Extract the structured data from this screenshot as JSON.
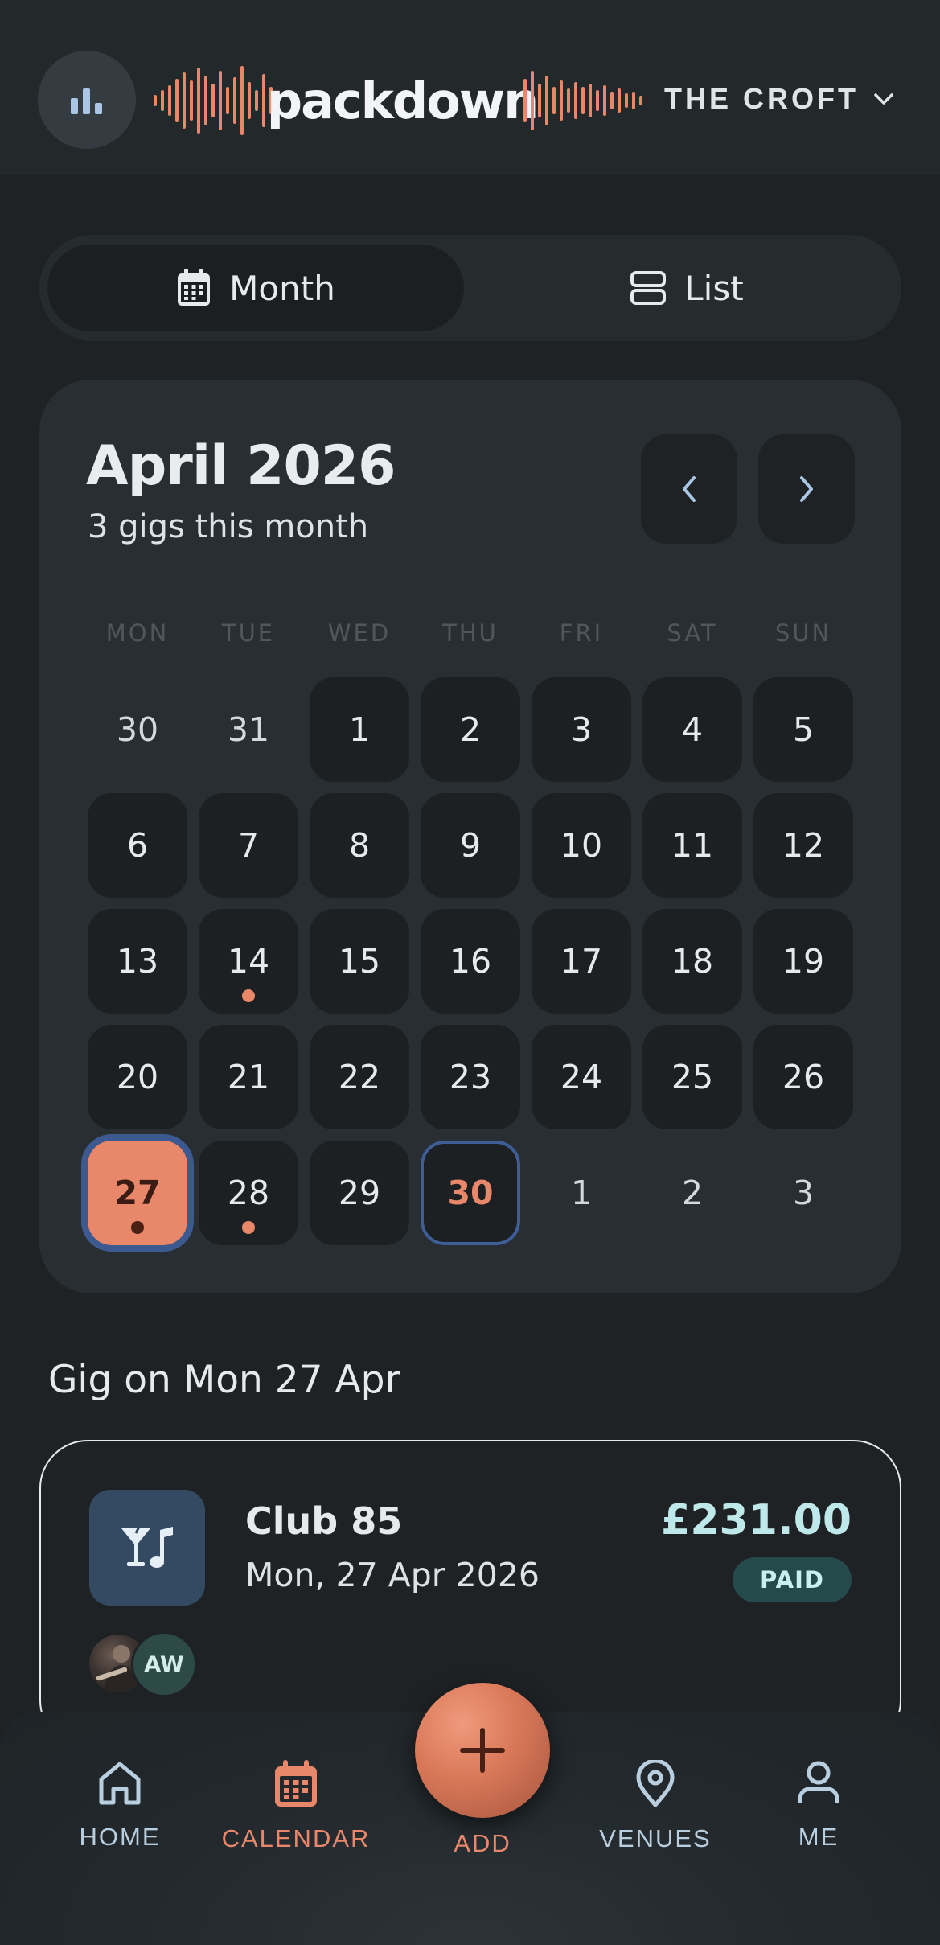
{
  "header": {
    "brand": "packdown",
    "venue": "THE CROFT",
    "icons": {
      "logo": "bar-chart-icon",
      "venue_toggle": "chevron-down-icon"
    }
  },
  "view_toggle": {
    "month_label": "Month",
    "list_label": "List",
    "active": "Month"
  },
  "calendar": {
    "title": "April 2026",
    "subtitle": "3 gigs this month",
    "weekdays": [
      "MON",
      "TUE",
      "WED",
      "THU",
      "FRI",
      "SAT",
      "SUN"
    ],
    "days": [
      {
        "label": "30",
        "in_month": false
      },
      {
        "label": "31",
        "in_month": false
      },
      {
        "label": "1",
        "in_month": true
      },
      {
        "label": "2",
        "in_month": true
      },
      {
        "label": "3",
        "in_month": true
      },
      {
        "label": "4",
        "in_month": true
      },
      {
        "label": "5",
        "in_month": true
      },
      {
        "label": "6",
        "in_month": true
      },
      {
        "label": "7",
        "in_month": true
      },
      {
        "label": "8",
        "in_month": true
      },
      {
        "label": "9",
        "in_month": true
      },
      {
        "label": "10",
        "in_month": true
      },
      {
        "label": "11",
        "in_month": true
      },
      {
        "label": "12",
        "in_month": true
      },
      {
        "label": "13",
        "in_month": true
      },
      {
        "label": "14",
        "in_month": true,
        "has_gig": true
      },
      {
        "label": "15",
        "in_month": true
      },
      {
        "label": "16",
        "in_month": true
      },
      {
        "label": "17",
        "in_month": true
      },
      {
        "label": "18",
        "in_month": true
      },
      {
        "label": "19",
        "in_month": true
      },
      {
        "label": "20",
        "in_month": true
      },
      {
        "label": "21",
        "in_month": true
      },
      {
        "label": "22",
        "in_month": true
      },
      {
        "label": "23",
        "in_month": true
      },
      {
        "label": "24",
        "in_month": true
      },
      {
        "label": "25",
        "in_month": true
      },
      {
        "label": "26",
        "in_month": true
      },
      {
        "label": "27",
        "in_month": true,
        "has_gig": true,
        "selected": true
      },
      {
        "label": "28",
        "in_month": true,
        "has_gig": true
      },
      {
        "label": "29",
        "in_month": true
      },
      {
        "label": "30",
        "in_month": true,
        "today": true
      },
      {
        "label": "1",
        "in_month": false
      },
      {
        "label": "2",
        "in_month": false
      },
      {
        "label": "3",
        "in_month": false
      }
    ]
  },
  "gig_section": {
    "heading": "Gig on Mon 27 Apr",
    "gig": {
      "venue": "Club 85",
      "date": "Mon, 27 Apr 2026",
      "amount": "£231.00",
      "status": "PAID",
      "icon": "cocktail-music-icon",
      "attendees": [
        {
          "type": "photo"
        },
        {
          "initials": "AW"
        }
      ]
    }
  },
  "bottom_nav": {
    "items": [
      {
        "label": "HOME",
        "icon": "home-icon"
      },
      {
        "label": "CALENDAR",
        "icon": "calendar-icon",
        "active": true
      },
      {
        "label": "VENUES",
        "icon": "map-pin-icon"
      },
      {
        "label": "ME",
        "icon": "user-icon"
      }
    ],
    "add_label": "ADD"
  },
  "colors": {
    "accent": "#e8876a",
    "background": "#1e2225",
    "card": "#292e32",
    "cell": "#1c2022",
    "selected_outline": "#3d5a90",
    "paid_bg": "#254a4b",
    "amount": "#bfe8ea"
  }
}
